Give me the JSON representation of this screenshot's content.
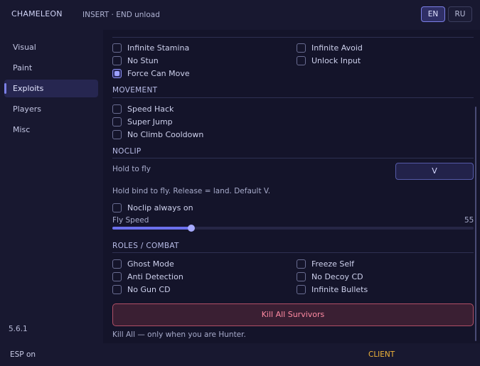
{
  "app": {
    "title": "CHAMELEON",
    "hint": "INSERT · END unload",
    "languages": [
      "EN",
      "RU"
    ],
    "active_language": "EN",
    "accent_color": "#7b7fe6"
  },
  "sidebar": {
    "items": [
      "Visual",
      "Paint",
      "Exploits",
      "Players",
      "Misc"
    ],
    "active": "Exploits",
    "version": "5.6.1"
  },
  "exploits": {
    "general": [
      {
        "label": "Infinite Stamina",
        "checked": false
      },
      {
        "label": "Infinite Avoid",
        "checked": false
      },
      {
        "label": "No Stun",
        "checked": false
      },
      {
        "label": "Unlock Input",
        "checked": false
      },
      {
        "label": "Force Can Move",
        "checked": true
      }
    ],
    "movement": {
      "title": "MOVEMENT",
      "items": [
        {
          "label": "Speed Hack",
          "checked": false
        },
        {
          "label": "Super Jump",
          "checked": false
        },
        {
          "label": "No Climb Cooldown",
          "checked": false
        }
      ]
    },
    "noclip": {
      "title": "NOCLIP",
      "hold_label": "Hold to fly",
      "bind_key": "V",
      "help": "Hold bind to fly. Release = land. Default V.",
      "always_on": {
        "label": "Noclip always on",
        "checked": false
      },
      "fly_speed": {
        "label": "Fly Speed",
        "value": 55,
        "fraction": 0.218
      }
    },
    "roles": {
      "title": "ROLES / COMBAT",
      "items": [
        {
          "label": "Ghost Mode",
          "checked": false
        },
        {
          "label": "Freeze Self",
          "checked": false
        },
        {
          "label": "Anti Detection",
          "checked": false
        },
        {
          "label": "No Decoy CD",
          "checked": false
        },
        {
          "label": "No Gun CD",
          "checked": false
        },
        {
          "label": "Infinite Bullets",
          "checked": false
        }
      ],
      "kill_all_label": "Kill All Survivors",
      "kill_all_note": "Kill All — only when you are Hunter."
    }
  },
  "status": {
    "esp": "ESP on",
    "mode": "CLIENT",
    "mode_color": "#f0b43a"
  }
}
